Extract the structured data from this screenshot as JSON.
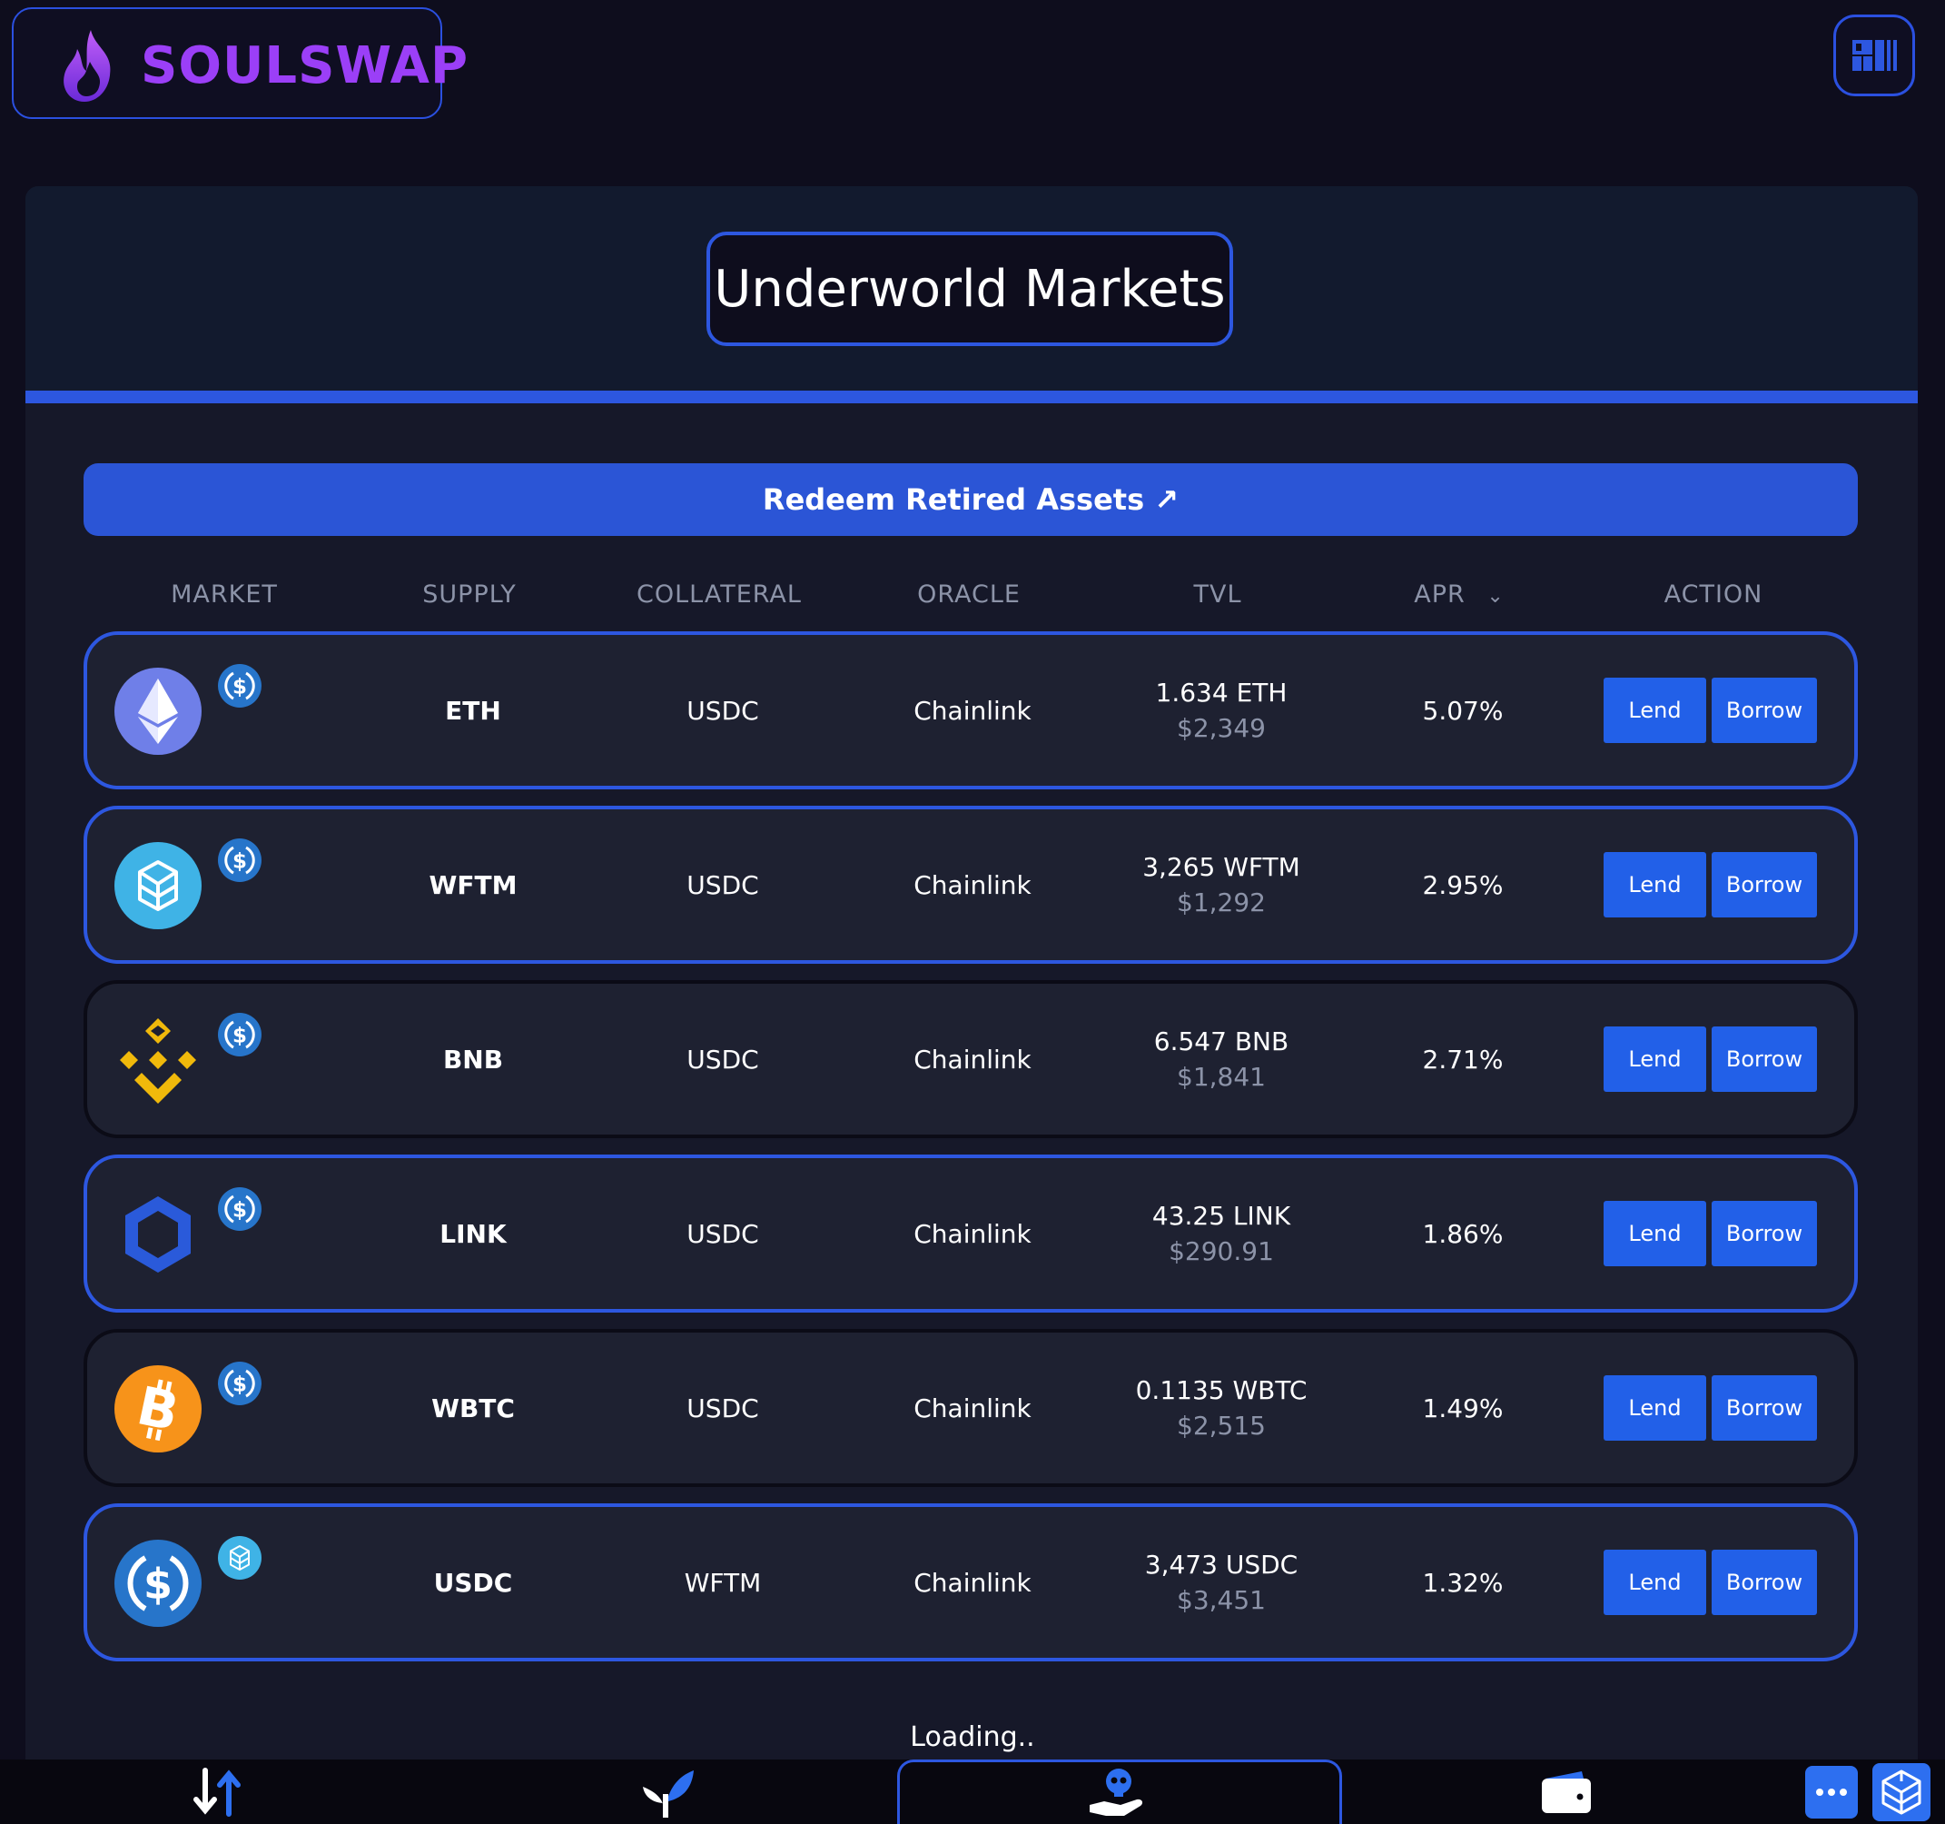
{
  "brand": {
    "name": "SOULSWAP",
    "color": "#9b3ff7"
  },
  "title": "Underworld Markets",
  "redeem_label": "Redeem Retired Assets ↗",
  "columns": {
    "market": "MARKET",
    "supply": "SUPPLY",
    "collateral": "COLLATERAL",
    "oracle": "ORACLE",
    "tvl": "TVL",
    "apr": "APR",
    "apr_sort_icon": "⌄",
    "action": "ACTION"
  },
  "markets": [
    {
      "icon": "eth-icon",
      "collateral_icon": "usdc-icon",
      "supply": "ETH",
      "collateral": "USDC",
      "oracle": "Chainlink",
      "tvl_amount": "1.634 ETH",
      "tvl_usd": "$2,349",
      "apr": "5.07%",
      "lend": "Lend",
      "borrow": "Borrow",
      "highlighted": true
    },
    {
      "icon": "fantom-icon",
      "collateral_icon": "usdc-icon",
      "supply": "WFTM",
      "collateral": "USDC",
      "oracle": "Chainlink",
      "tvl_amount": "3,265 WFTM",
      "tvl_usd": "$1,292",
      "apr": "2.95%",
      "lend": "Lend",
      "borrow": "Borrow",
      "highlighted": true
    },
    {
      "icon": "bnb-icon",
      "collateral_icon": "usdc-icon",
      "supply": "BNB",
      "collateral": "USDC",
      "oracle": "Chainlink",
      "tvl_amount": "6.547 BNB",
      "tvl_usd": "$1,841",
      "apr": "2.71%",
      "lend": "Lend",
      "borrow": "Borrow",
      "highlighted": false
    },
    {
      "icon": "chainlink-icon",
      "collateral_icon": "usdc-icon",
      "supply": "LINK",
      "collateral": "USDC",
      "oracle": "Chainlink",
      "tvl_amount": "43.25 LINK",
      "tvl_usd": "$290.91",
      "apr": "1.86%",
      "lend": "Lend",
      "borrow": "Borrow",
      "highlighted": true
    },
    {
      "icon": "bitcoin-icon",
      "collateral_icon": "usdc-icon",
      "supply": "WBTC",
      "collateral": "USDC",
      "oracle": "Chainlink",
      "tvl_amount": "0.1135 WBTC",
      "tvl_usd": "$2,515",
      "apr": "1.49%",
      "lend": "Lend",
      "borrow": "Borrow",
      "highlighted": false
    },
    {
      "icon": "usdc-icon",
      "collateral_icon": "fantom-icon",
      "supply": "USDC",
      "collateral": "WFTM",
      "oracle": "Chainlink",
      "tvl_amount": "3,473 USDC",
      "tvl_usd": "$3,451",
      "apr": "1.32%",
      "lend": "Lend",
      "borrow": "Borrow",
      "highlighted": true
    }
  ],
  "loading_text": "Loading..",
  "nav": [
    "swap-icon",
    "farm-sprout-icon",
    "lending-skull-hand-icon",
    "wallet-icon",
    "more-icon",
    "fantom-network-icon"
  ],
  "colors": {
    "accent": "#2d57e0",
    "button": "#2260e8",
    "background": "#0e0d1d",
    "row": "#1e2131"
  }
}
